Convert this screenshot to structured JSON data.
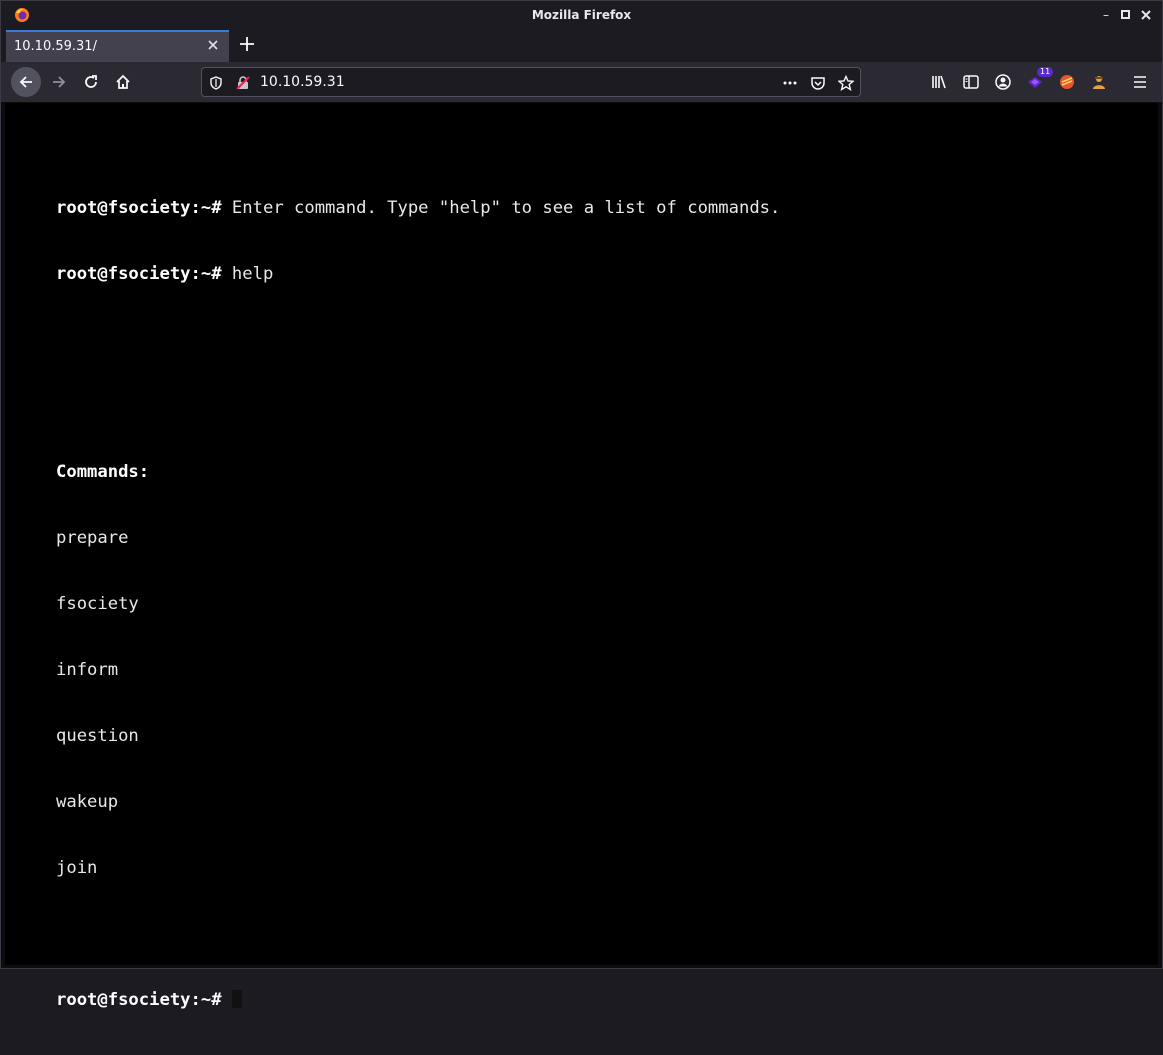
{
  "window": {
    "title": "Mozilla Firefox"
  },
  "tab": {
    "title": "10.10.59.31/"
  },
  "urlbar": {
    "url": "10.10.59.31"
  },
  "toolbar": {
    "extension_badge": "11"
  },
  "terminal": {
    "prompt": "root@fsociety:~#",
    "line1_text": " Enter command. Type \"help\" to see a list of commands.",
    "line2_text": " help",
    "commands_heading": "Commands:",
    "commands": [
      "prepare",
      "fsociety",
      "inform",
      "question",
      "wakeup",
      "join"
    ]
  },
  "colors": {
    "accent": "#3b7bd8",
    "background": "#000000",
    "text": "#e8e8e8"
  }
}
